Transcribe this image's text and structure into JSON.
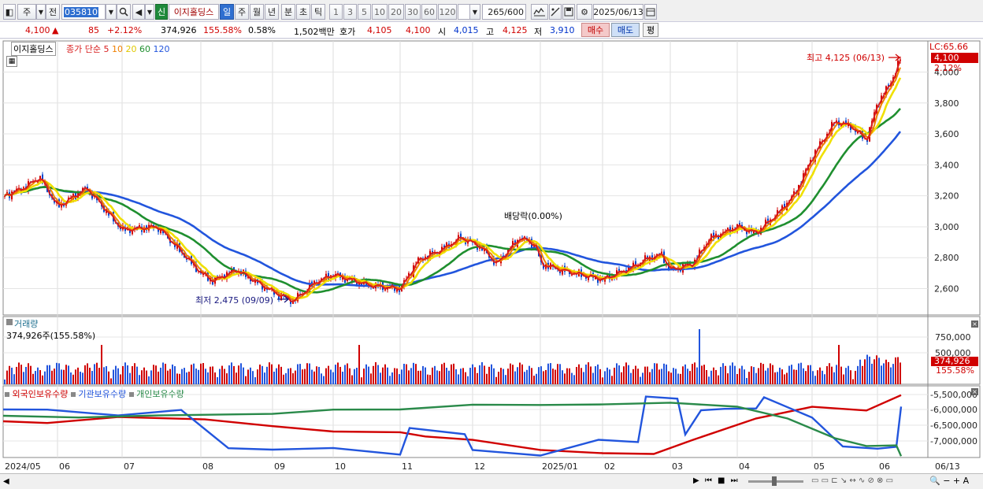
{
  "toolbar": {
    "market": "주",
    "prev_label": "전",
    "code": "035810",
    "stock_name": "이지홀딩스",
    "credit_badge": "신",
    "periods": [
      "일",
      "주",
      "월",
      "년",
      "분",
      "초",
      "틱"
    ],
    "active_period": "일",
    "intervals": [
      "1",
      "3",
      "5",
      "10",
      "20",
      "30",
      "60",
      "120"
    ],
    "count": "265",
    "count_total": "/600",
    "date": "2025/06/13"
  },
  "quote": {
    "price": "4,100",
    "arrow": "▲",
    "change": "85",
    "change_pct": "+2.12%",
    "volume": "374,926",
    "volume_ratio": "155.58%",
    "turnover": "0.58%",
    "amount": "1,502백만",
    "hoga_label": "호가",
    "ask": "4,105",
    "bid": "4,100",
    "open_label": "시",
    "open": "4,015",
    "high_label": "고",
    "high": "4,125",
    "low_label": "저",
    "low": "3,910",
    "buy_button": "매수",
    "sell_button": "매도",
    "avg_button": "평"
  },
  "main_panel": {
    "name_tag": "이지홀딩스",
    "ma_title": "종가 단순",
    "ma_periods": [
      "5",
      "10",
      "20",
      "60",
      "120"
    ],
    "ma_colors": [
      "#d81e1e",
      "#f08000",
      "#f0e000",
      "#1f8f2f",
      "#2255dd"
    ],
    "lc_label": "LC:65.66",
    "price_tag": "4,100",
    "pct_tag": "2.12%",
    "y_ticks": [
      "4,000",
      "3,800",
      "3,600",
      "3,400",
      "3,200",
      "3,000",
      "2,800",
      "2,600"
    ],
    "high_annotation": "최고 4,125 (06/13)",
    "low_annotation": "최저 2,475 (09/09)",
    "dividend_annotation": "배당락(0.00%)"
  },
  "volume_panel": {
    "title": "거래량",
    "subtitle": "374,926주(155.58%)",
    "y_ticks": [
      "750,000",
      "500,000"
    ],
    "value_tag": "374,926",
    "pct_tag": "155.58%"
  },
  "holdings_panel": {
    "series": [
      {
        "name": "외국인보유수량",
        "color": "#d00000"
      },
      {
        "name": "기관보유수량",
        "color": "#2255dd"
      },
      {
        "name": "개인보유수량",
        "color": "#2a8a4a"
      }
    ],
    "y_ticks": [
      "-5,500,000",
      "-6,000,000",
      "-6,500,000",
      "-7,000,000"
    ]
  },
  "x_axis": {
    "labels": [
      "2024/05",
      "06",
      "07",
      "08",
      "09",
      "10",
      "11",
      "12",
      "2025/01",
      "02",
      "03",
      "04",
      "05",
      "06"
    ],
    "right_label": "06/13"
  },
  "chart_data": {
    "type": "line",
    "price_axis": {
      "ylim": [
        2450,
        4150
      ],
      "ticks": [
        4000,
        3800,
        3600,
        3400,
        3200,
        3000,
        2800,
        2600
      ]
    },
    "price_series": [
      {
        "month": "2024/05",
        "close": 3220
      },
      {
        "month": "06",
        "close": 3120
      },
      {
        "month": "07",
        "close": 2960
      },
      {
        "month": "08",
        "close": 2680
      },
      {
        "month": "09",
        "close": 2550
      },
      {
        "month": "10",
        "close": 2680
      },
      {
        "month": "11",
        "close": 2820
      },
      {
        "month": "12",
        "close": 2880
      },
      {
        "month": "2025/01",
        "close": 2720
      },
      {
        "month": "02",
        "close": 2790
      },
      {
        "month": "03",
        "close": 2840
      },
      {
        "month": "04",
        "close": 2980
      },
      {
        "month": "05",
        "close": 3700
      },
      {
        "month": "06/13",
        "close": 4100
      }
    ],
    "annotations": [
      {
        "label": "최고",
        "value": 4125,
        "date": "06/13"
      },
      {
        "label": "최저",
        "value": 2475,
        "date": "09/09"
      }
    ]
  }
}
